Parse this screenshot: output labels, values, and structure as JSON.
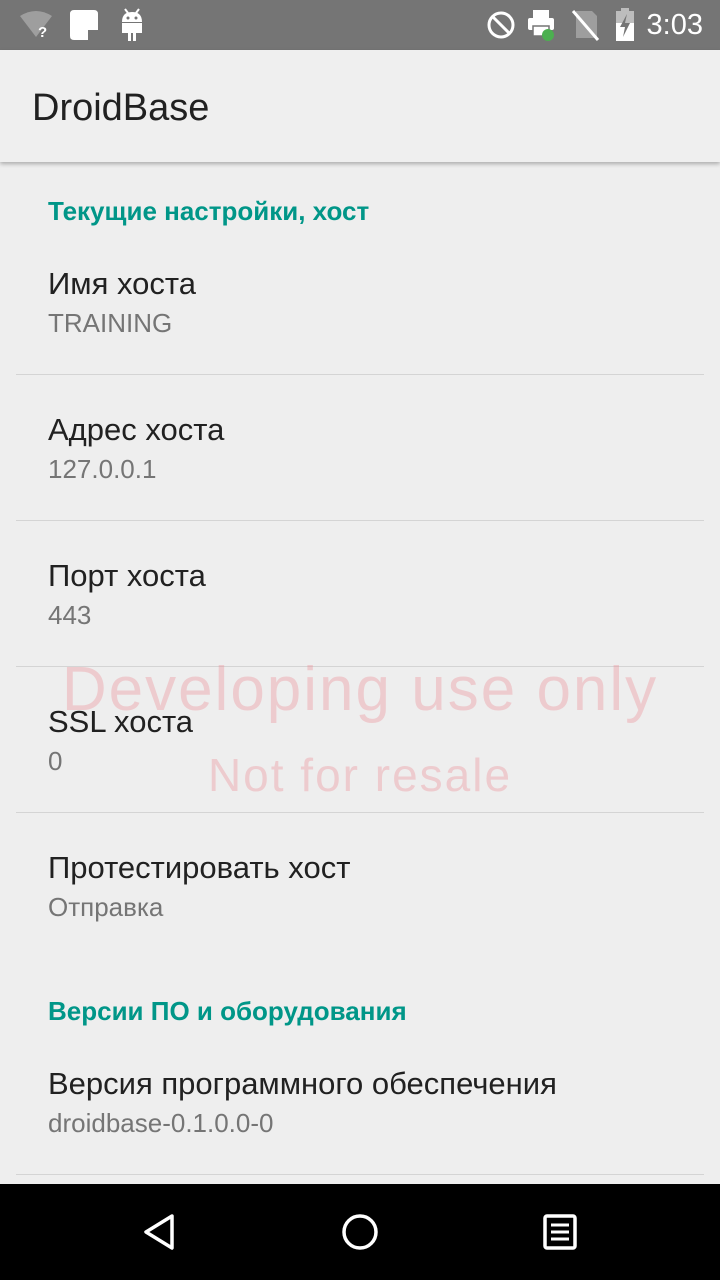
{
  "status_bar": {
    "time": "3:03",
    "icons": [
      "wifi-unknown-icon",
      "sim-card-icon",
      "android-icon",
      "do-not-disturb-icon",
      "printer-icon",
      "no-sim-icon",
      "battery-charging-icon"
    ]
  },
  "app_bar": {
    "title": "DroidBase"
  },
  "sections": [
    {
      "title": "Текущие настройки, хост",
      "items": [
        {
          "title": "Имя хоста",
          "summary": "TRAINING"
        },
        {
          "title": "Адрес хоста",
          "summary": "127.0.0.1"
        },
        {
          "title": "Порт хоста",
          "summary": "443"
        },
        {
          "title": "SSL хоста",
          "summary": "0"
        },
        {
          "title": "Протестировать хост",
          "summary": "Отправка"
        }
      ]
    },
    {
      "title": "Версии ПО и оборудования",
      "items": [
        {
          "title": "Версия программного обеспечения",
          "summary": "droidbase-0.1.0.0-0"
        }
      ]
    }
  ],
  "watermark": {
    "line1": "Developing use only",
    "line2": "Not for resale"
  },
  "colors": {
    "accent": "#009688",
    "status_bar": "#757575",
    "background": "#eeeeee",
    "nav_bar": "#000000"
  }
}
